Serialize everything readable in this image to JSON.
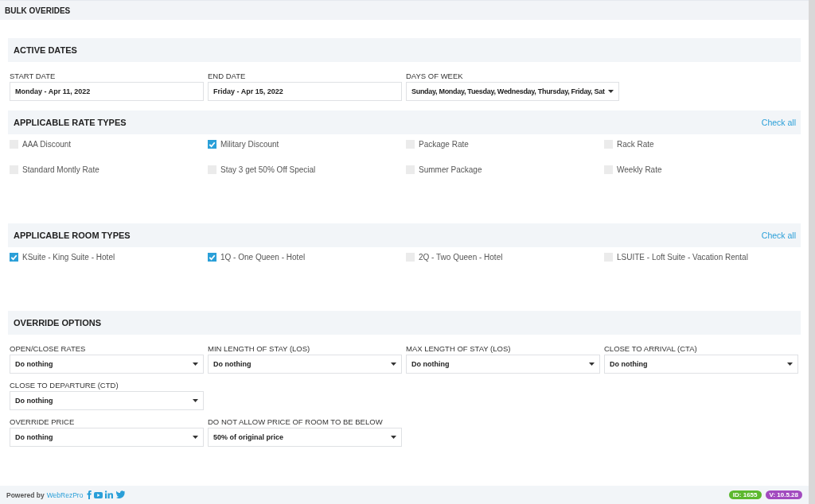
{
  "title": "BULK OVERIDES",
  "sections": [
    {
      "kind": "fields",
      "title": "ACTIVE DATES",
      "rows": [
        [
          {
            "kind": "input",
            "label": "START DATE",
            "value": "Monday - Apr 11, 2022"
          },
          {
            "kind": "input",
            "label": "END DATE",
            "value": "Friday - Apr 15, 2022"
          },
          {
            "kind": "compact-dropdown",
            "label": "DAYS OF WEEK",
            "value": "Sunday, Monday, Tuesday, Wednesday, Thursday, Friday, Sat"
          }
        ]
      ]
    },
    {
      "kind": "checks",
      "title": "APPLICABLE RATE TYPES",
      "action": "Check all",
      "items": [
        {
          "label": "AAA Discount",
          "checked": false
        },
        {
          "label": "Military Discount",
          "checked": true
        },
        {
          "label": "Package Rate",
          "checked": false
        },
        {
          "label": "Rack Rate",
          "checked": false
        },
        {
          "label": "Standard Montly Rate",
          "checked": false
        },
        {
          "label": "Stay 3 get 50% Off Special",
          "checked": false
        },
        {
          "label": "Summer Package",
          "checked": false
        },
        {
          "label": "Weekly Rate",
          "checked": false
        }
      ]
    },
    {
      "kind": "checks",
      "title": "APPLICABLE ROOM TYPES",
      "action": "Check all",
      "items": [
        {
          "label": "KSuite - King Suite - Hotel",
          "checked": true
        },
        {
          "label": "1Q - One Queen - Hotel",
          "checked": true
        },
        {
          "label": "2Q - Two Queen - Hotel",
          "checked": false
        },
        {
          "label": "LSUITE - Loft Suite - Vacation Rental",
          "checked": false
        }
      ]
    },
    {
      "kind": "fields",
      "title": "OVERRIDE OPTIONS",
      "rows": [
        [
          {
            "kind": "dropdown",
            "label": "OPEN/CLOSE RATES",
            "value": "Do nothing"
          },
          {
            "kind": "dropdown",
            "label": "MIN LENGTH OF STAY (LOS)",
            "value": "Do nothing"
          },
          {
            "kind": "dropdown",
            "label": "MAX LENGTH OF STAY (LOS)",
            "value": "Do nothing"
          },
          {
            "kind": "dropdown",
            "label": "CLOSE TO ARRIVAL (CTA)",
            "value": "Do nothing"
          }
        ],
        [
          {
            "kind": "dropdown",
            "label": "CLOSE TO DEPARTURE (CTD)",
            "value": "Do nothing"
          }
        ],
        [
          {
            "kind": "dropdown",
            "label": "OVERRIDE PRICE",
            "value": "Do nothing"
          },
          {
            "kind": "dropdown",
            "label": "DO NOT ALLOW PRICE OF ROOM TO BE BELOW",
            "value": "50% of original price"
          }
        ]
      ]
    }
  ],
  "footer": {
    "powered_by": "Powered by",
    "brand": "WebRezPro",
    "badges": [
      {
        "text": "ID: 1655",
        "color": "#5cb82e"
      },
      {
        "text": "V: 10.5.28",
        "color": "#a24bbf"
      }
    ]
  }
}
